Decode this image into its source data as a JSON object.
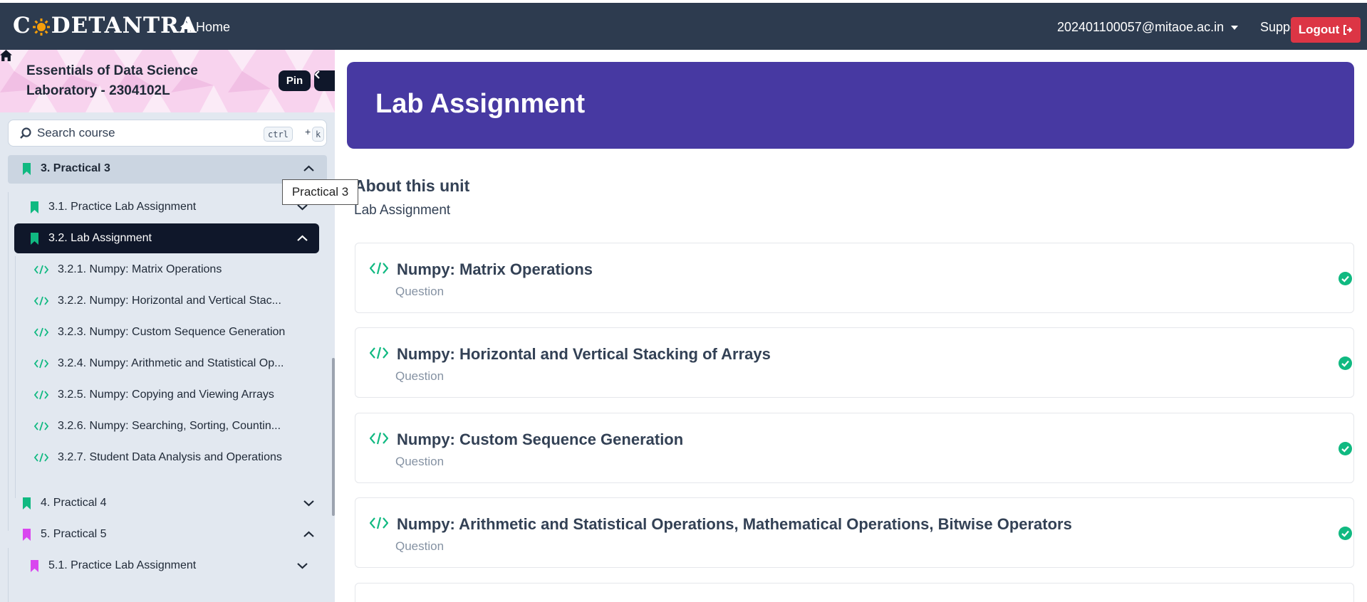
{
  "topbar": {
    "logo": "CODETANTRA",
    "home_label": "Home",
    "user_email": "202401100057@mitaoe.ac.in",
    "support_label": "Support",
    "logout_label": "Logout"
  },
  "sidebar": {
    "course_title": "Essentials of Data Science Laboratory - 2304102L",
    "pin_label": "Pin",
    "search_placeholder": "Search course",
    "shortcut_ctrl": "ctrl",
    "shortcut_plus": "+",
    "shortcut_k": "k",
    "items": [
      {
        "label": "3. Practical 3",
        "color": "#10b981"
      },
      {
        "label": "3.1. Practice Lab Assignment",
        "color": "#10b981"
      },
      {
        "label": "3.2. Lab Assignment",
        "color": "#10b981"
      },
      {
        "label": "3.2.1. Numpy: Matrix Operations"
      },
      {
        "label": "3.2.2. Numpy: Horizontal and Vertical Stac..."
      },
      {
        "label": "3.2.3. Numpy: Custom Sequence Generation"
      },
      {
        "label": "3.2.4. Numpy: Arithmetic and Statistical Op..."
      },
      {
        "label": "3.2.5. Numpy: Copying and Viewing Arrays"
      },
      {
        "label": "3.2.6. Numpy: Searching, Sorting, Countin..."
      },
      {
        "label": "3.2.7. Student Data Analysis and Operations"
      },
      {
        "label": "4. Practical 4",
        "color": "#10b981"
      },
      {
        "label": "5. Practical 5",
        "color": "#d946ef"
      },
      {
        "label": "5.1. Practice Lab Assignment",
        "color": "#d946ef"
      }
    ]
  },
  "tooltip": "Practical 3",
  "main": {
    "banner_title": "Lab Assignment",
    "about_title": "About this unit",
    "about_sub": "Lab Assignment",
    "cards": [
      {
        "title": "Numpy: Matrix Operations",
        "type": "Question"
      },
      {
        "title": "Numpy: Horizontal and Vertical Stacking of Arrays",
        "type": "Question"
      },
      {
        "title": "Numpy: Custom Sequence Generation",
        "type": "Question"
      },
      {
        "title": "Numpy: Arithmetic and Statistical Operations, Mathematical Operations, Bitwise Operators",
        "type": "Question"
      }
    ]
  },
  "colors": {
    "topbar": "#2d3b4f",
    "banner": "#4739a2",
    "accent_green": "#10b981",
    "logout": "#dc3545",
    "selected": "#0f172a"
  }
}
